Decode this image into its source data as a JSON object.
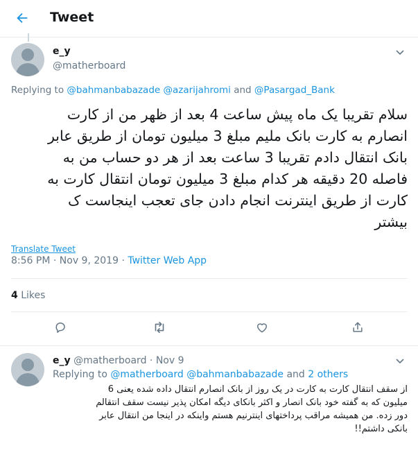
{
  "header": {
    "title": "Tweet"
  },
  "tweet": {
    "name": "e_y",
    "handle": "@matherboard",
    "replying_prefix": "Replying to ",
    "mentions": [
      "@bahmanbabazade",
      "@azarijahromi",
      "@Pasargad_Bank"
    ],
    "mention_and": " and ",
    "text_lines": [
      "سلام تقریبا یک ماه پیش ساعت 4 بعد از ظهر من از کارت",
      "انصارم به کارت بانک ملیم مبلغ 3 میلیون تومان از طریق عابر",
      "بانک انتقال دادم تقریبا 3 ساعت بعد از هر دو حساب من به",
      "فاصله 20 دقیقه هر کدام مبلغ 3 میلیون تومان انتقال کارت به",
      "کارت از طریق اینترنت انجام دادن جای تعجب اینجاست ک",
      "بیشتر"
    ],
    "translate": "Translate Tweet",
    "time": "8:56 PM",
    "date": "Nov 9, 2019",
    "dot": " · ",
    "source": "Twitter Web App",
    "likes_count": "4",
    "likes_label": "Likes"
  },
  "reply": {
    "name": "e_y",
    "handle": "@matherboard",
    "date": "Nov 9",
    "replying_prefix": "Replying to ",
    "mentions": "@matherboard @bahmanbabazade",
    "and_text": " and ",
    "others": "2 others",
    "text_lines": [
      "از سقف انتقال کارت به کارت در یک روز از بانک انصارم انتقال داده شده یعنی 6",
      "میلیون که به گفته خود بانک انصار و اکثر بانکای دیگه امکان پذیر نیست سقف انتقالم",
      "دور زده. من همیشه مراقب پرداختهای اینترنیم هستم واینکه در اینجا من انتقال عابر",
      "بانکی داشتم!!"
    ]
  },
  "colors": {
    "link": "#1b95e0",
    "muted": "#657786",
    "text": "#14171a",
    "border": "#e6ecf0"
  }
}
